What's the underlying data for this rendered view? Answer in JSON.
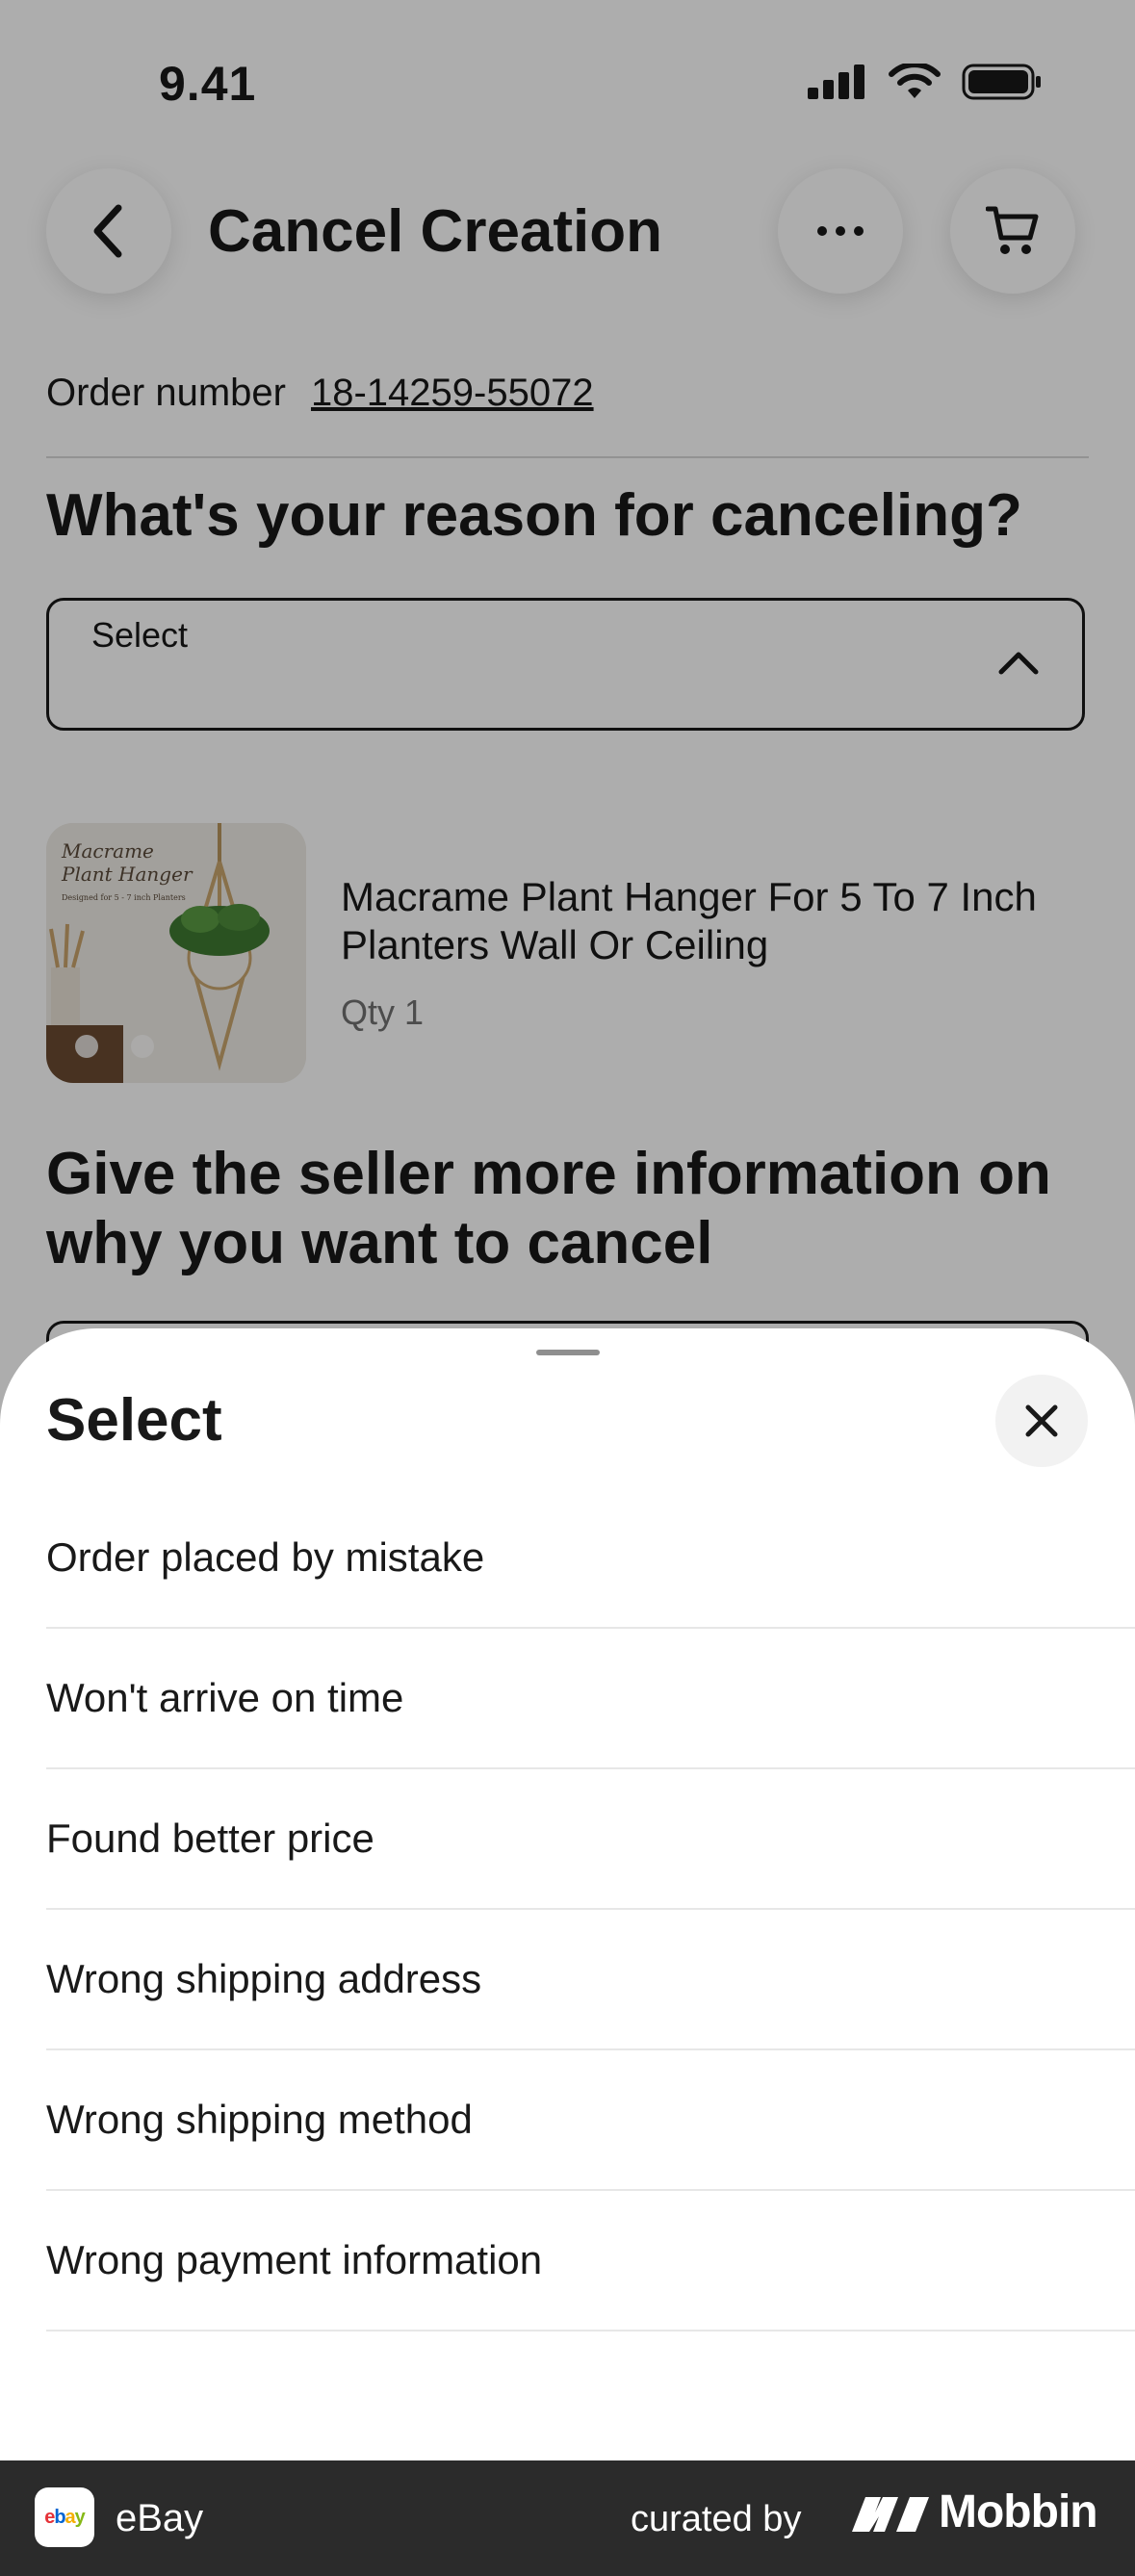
{
  "status_bar": {
    "time": "9.41"
  },
  "header": {
    "title": "Cancel Creation"
  },
  "order": {
    "label": "Order number",
    "number": "18-14259-55072"
  },
  "reason": {
    "heading": "What's your reason for canceling?",
    "select_label": "Select"
  },
  "item": {
    "title": "Macrame Plant Hanger For 5 To 7 Inch Planters Wall Or Ceiling",
    "qty": "Qty 1",
    "image_text": {
      "line1": "Macrame",
      "line2": "Plant Hanger",
      "line3": "Designed for 5 - 7 inch Planters"
    }
  },
  "more_info": {
    "heading": "Give the seller more information on why you want to cancel"
  },
  "sheet": {
    "title": "Select",
    "options": [
      "Order placed by mistake",
      "Won't arrive on time",
      "Found better price",
      "Wrong shipping address",
      "Wrong shipping method",
      "Wrong payment information"
    ]
  },
  "footer": {
    "badge": "ebay",
    "app_name": "eBay",
    "curated_by": "curated by",
    "brand": "Mobbin"
  },
  "colors": {
    "scrim": "#00000052",
    "footer_bg": "#2b2b2b",
    "ebay_red": "#e53238",
    "ebay_blue": "#0064d2",
    "ebay_yellow": "#f5af02",
    "ebay_green": "#86b817"
  }
}
